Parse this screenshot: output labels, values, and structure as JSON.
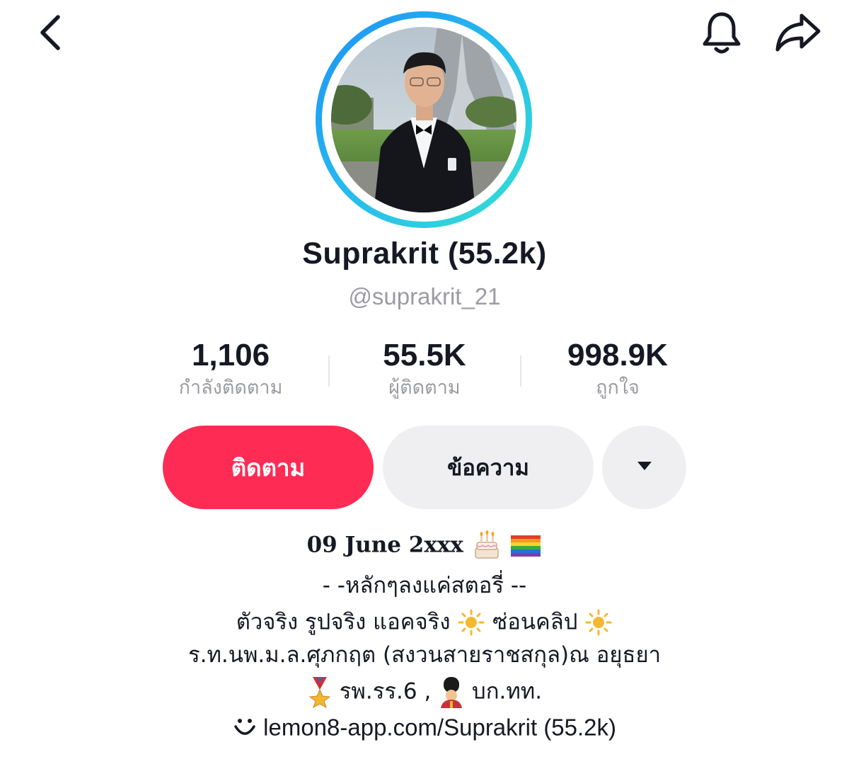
{
  "header": {
    "back_icon": "chevron-left-icon",
    "bell_icon": "bell-icon",
    "share_icon": "share-arrow-icon"
  },
  "profile": {
    "display_name": "Suprakrit (55.2k)",
    "username": "@suprakrit_21",
    "avatar_ring_colors": [
      "#1e90f5",
      "#34e1d2"
    ]
  },
  "stats": [
    {
      "value": "1,106",
      "label": "กำลังติดตาม"
    },
    {
      "value": "55.5K",
      "label": "ผู้ติดตาม"
    },
    {
      "value": "998.9K",
      "label": "ถูกใจ"
    }
  ],
  "actions": {
    "follow_label": "ติดตาม",
    "message_label": "ข้อความ",
    "more_icon": "caret-down-icon",
    "follow_color": "#fe2c55"
  },
  "bio": {
    "birthday": "09 June 2xxx",
    "birthday_emojis": [
      "birthday-cake-emoji",
      "rainbow-flag-emoji"
    ],
    "line2": "- -หลักๆลงแค่สตอรี่ --",
    "line3_a": "ตัวจริง รูปจริง แอคจริง",
    "line3_b": "ซ่อนคลิป",
    "line3_emoji": "sun-emoji",
    "line4": "ร.ท.นพ.ม.ล.ศุภกฤต (สงวนสายราชสกุล)ณ อยุธยา",
    "line5_a": "รพ.รร.6 ,",
    "line5_b": "บก.ทท.",
    "line5_emojis": [
      "military-medal-emoji",
      "guard-emoji"
    ],
    "link_icon": "smile-link-icon",
    "link": "lemon8-app.com/Suprakrit (55.2k)"
  }
}
